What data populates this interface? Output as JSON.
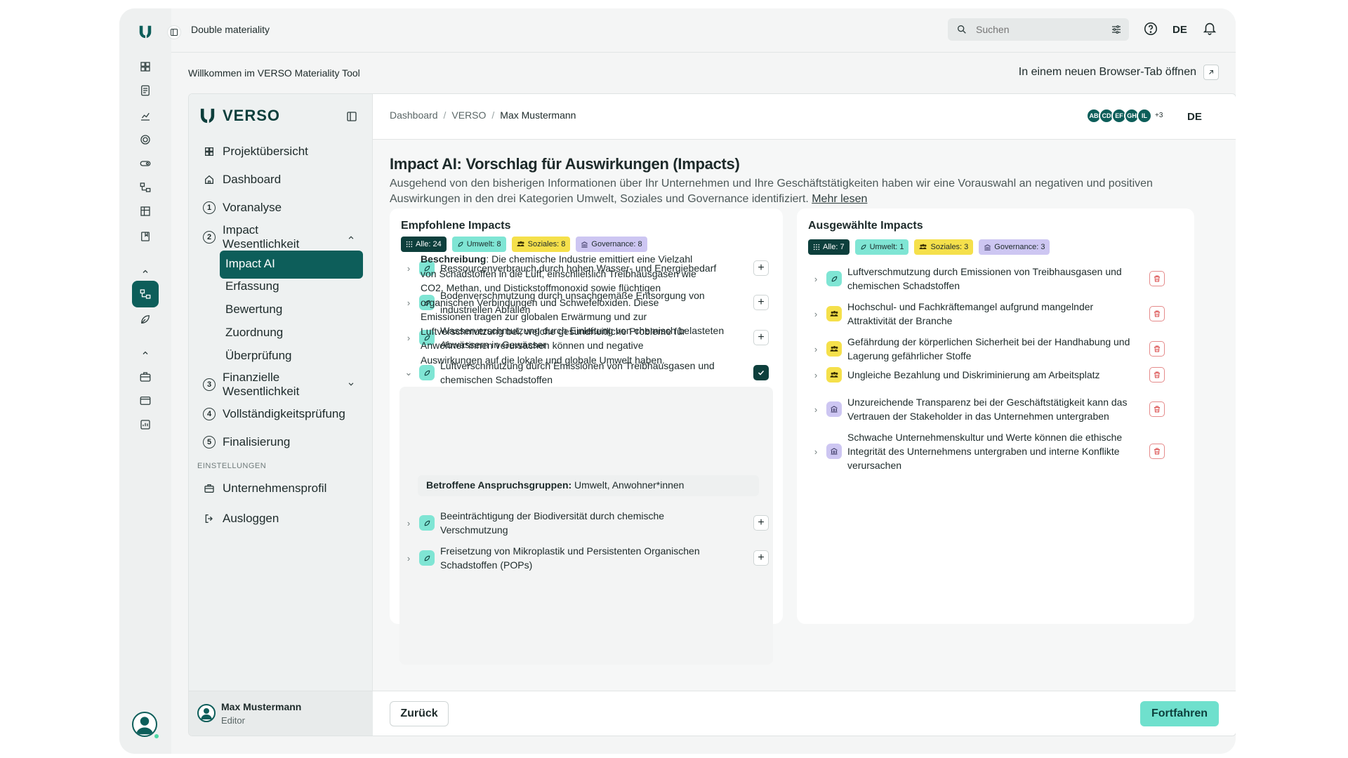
{
  "window": {
    "title": "Double materiality"
  },
  "search": {
    "placeholder": "Suchen"
  },
  "topbar": {
    "lang": "DE"
  },
  "welcome": "Willkommen im VERSO Materiality Tool",
  "new_tab": "In einem neuen Browser-Tab öffnen",
  "brand": "VERSO",
  "sidebar": {
    "items": [
      {
        "label": "Projektübersicht",
        "icon": "grid-icon"
      },
      {
        "label": "Dashboard",
        "icon": "home-icon"
      },
      {
        "num": "1",
        "label": "Voranalyse"
      },
      {
        "num": "2",
        "label": "Impact\nWesentlichkeit"
      },
      {
        "num": "3",
        "label": "Finanzielle\nWesentlichkeit"
      },
      {
        "num": "4",
        "label": "Vollständigkeitsprüfung"
      },
      {
        "num": "5",
        "label": "Finalisierung"
      }
    ],
    "sub_items": [
      "Impact AI",
      "Erfassung",
      "Bewertung",
      "Zuordnung",
      "Überprüfung"
    ],
    "settings_label": "EINSTELLUNGEN",
    "settings_items": [
      "Unternehmensprofil",
      "Ausloggen"
    ]
  },
  "user": {
    "name": "Max Mustermann",
    "role": "Editor"
  },
  "breadcrumb": [
    "Dashboard",
    "VERSO",
    "Max Mustermann"
  ],
  "avatars": [
    "AB",
    "CD",
    "EF",
    "GH",
    "IL"
  ],
  "avatars_more": "+3",
  "content_lang": "DE",
  "page": {
    "title": "Impact AI: Vorschlag für Auswirkungen (Impacts)",
    "intro": "Ausgehend von den bisherigen Informationen über Ihr Unternehmen und Ihre Geschäftstätigkeiten haben wir eine Vorauswahl an negativen und positiven Auswirkungen in den drei Kategorien Umwelt, Soziales und Governance identifiziert.",
    "read_more": "Mehr lesen"
  },
  "recommended": {
    "title": "Empfohlene Impacts",
    "chips": [
      "Alle: 24",
      "Umwelt: 8",
      "Soziales: 8",
      "Governance: 8"
    ],
    "items": [
      "Ressourcenverbrauch durch hohen Wasser- und Energiebedarf",
      "Bodenverschmutzung durch unsachgemäße Entsorgung von industriellen Abfällen",
      "Wasserverschmutzung durch Einleitung von chemisch belasteten Abwässern in Gewässer",
      "Luftverschmutzung durch Emissionen von Treibhausgasen und chemischen Schadstoffen",
      "Beeinträchtigung der Biodiversität durch chemische Verschmutzung",
      "Freisetzung von Mikroplastik und Persistenten Organischen Schadstoffen (POPs)"
    ],
    "detail": {
      "desc_label": "Beschreibung",
      "desc": "Die chemische Industrie emittiert eine Vielzahl von Schadstoffen in die Luft, einschließlich Treibhausgasen wie CO2, Methan, und Distickstoffmonoxid sowie flüchtigen organischen Verbindungen und Schwefeloxiden. Diese Emissionen tragen zur globalen Erwärmung und zur Luftverschmutzung bei, welche gesundheitliche Probleme für Anwohner*innen verursachen können und negative Auswirkungen auf die lokale und globale Umwelt haben.",
      "affected_label": "Betroffene Anspruchsgruppen:",
      "affected": "Umwelt, Anwohner*innen"
    }
  },
  "selected": {
    "title": "Ausgewählte Impacts",
    "chips": [
      "Alle: 7",
      "Umwelt: 1",
      "Soziales: 3",
      "Governance: 3"
    ],
    "items": [
      {
        "text": "Luftverschmutzung durch Emissionen von Treibhausgasen und chemischen Schadstoffen",
        "cat": "um"
      },
      {
        "text": "Hochschul- und Fachkräftemangel aufgrund mangelnder Attraktivität der Branche",
        "cat": "so"
      },
      {
        "text": "Gefährdung der körperlichen Sicherheit bei der Handhabung und Lagerung gefährlicher Stoffe",
        "cat": "so"
      },
      {
        "text": "Ungleiche Bezahlung und Diskriminierung am Arbeitsplatz",
        "cat": "so"
      },
      {
        "text": "Unzureichende Transparenz bei der Geschäftstätigkeit kann das Vertrauen der Stakeholder in das Unternehmen untergraben",
        "cat": "go"
      },
      {
        "text": "Schwache Unternehmenskultur und Werte können die ethische Integrität des Unternehmens untergraben und interne Konflikte verursachen",
        "cat": "go"
      }
    ]
  },
  "footer": {
    "back": "Zurück",
    "next": "Fortfahren"
  },
  "colors": {
    "brand": "#0d5e5a",
    "umwelt": "#7fe5d4",
    "soziales": "#f5e04b",
    "governance": "#cdc6f2",
    "cta": "#6fe0cd"
  }
}
